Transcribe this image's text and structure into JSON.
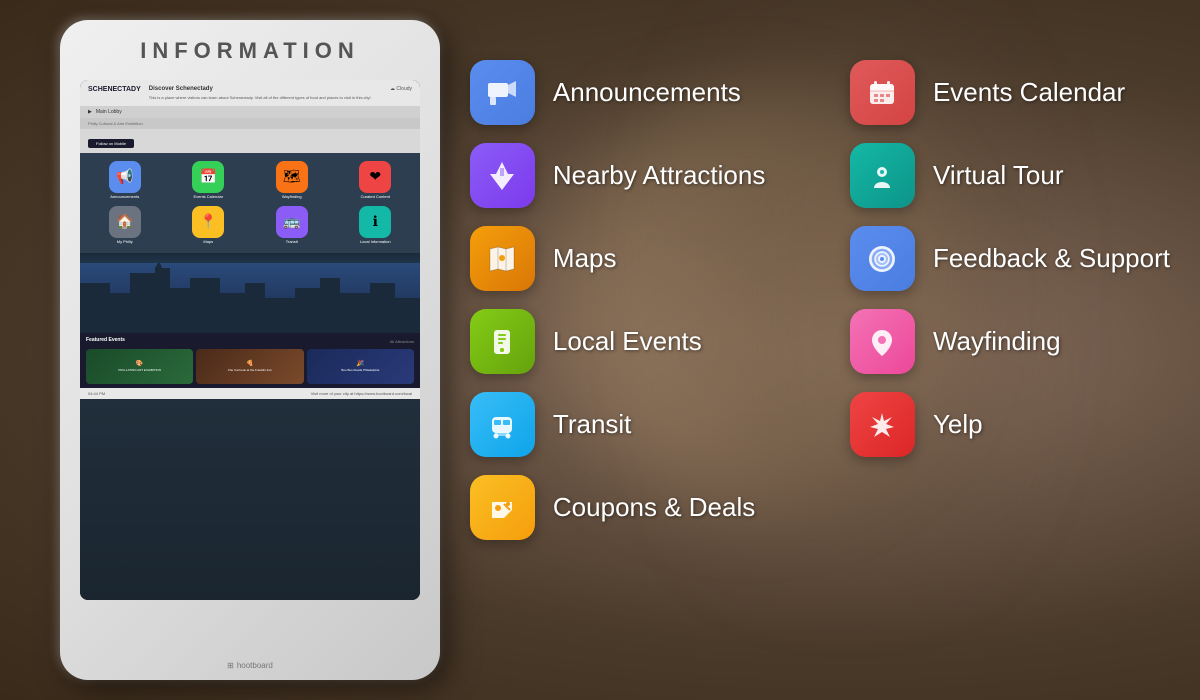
{
  "background": {
    "color": "#5a4a3a"
  },
  "kiosk": {
    "title": "INFORMATION",
    "brand": "hootboard",
    "screen": {
      "city_name": "Discover Schenectady",
      "location_text": "Main Lobby",
      "weather": "☁ Cloudy",
      "bottom_text": "04:44 PM",
      "bottom_url": "Visit more of your city at https://www.hootboard.com/local",
      "featured_label": "Featured Events",
      "icons": [
        {
          "label": "Announcements",
          "color": "sic-blue",
          "icon": "📢"
        },
        {
          "label": "Events Calendar",
          "color": "sic-green",
          "icon": "📅"
        },
        {
          "label": "Wayfinding",
          "color": "sic-orange",
          "icon": "🗺"
        },
        {
          "label": "Curated Content",
          "color": "sic-red",
          "icon": "❤"
        },
        {
          "label": "My Philly",
          "color": "sic-gray",
          "icon": "🏠"
        },
        {
          "label": "Maps",
          "color": "sic-yellow",
          "icon": "📍"
        },
        {
          "label": "Transit",
          "color": "sic-purple",
          "icon": "🚌"
        },
        {
          "label": "Local Information",
          "color": "sic-teal",
          "icon": "ℹ"
        }
      ]
    }
  },
  "menu": {
    "left_column": [
      {
        "id": "announcements",
        "label": "Announcements",
        "icon": "📢",
        "color_class": "ic-blue"
      },
      {
        "id": "nearby-attractions",
        "label": "Nearby Attractions",
        "icon": "🗽",
        "color_class": "ic-purple"
      },
      {
        "id": "maps",
        "label": "Maps",
        "icon": "🗺",
        "color_class": "ic-yellow"
      },
      {
        "id": "local-events",
        "label": "Local Events",
        "icon": "📱",
        "color_class": "ic-lime"
      },
      {
        "id": "transit",
        "label": "Transit",
        "icon": "🚌",
        "color_class": "ic-sky"
      },
      {
        "id": "coupons-deals",
        "label": "Coupons & Deals",
        "icon": "🏷",
        "color_class": "ic-gold"
      }
    ],
    "right_column": [
      {
        "id": "events-calendar",
        "label": "Events Calendar",
        "icon": "📅",
        "color_class": "ic-red"
      },
      {
        "id": "virtual-tour",
        "label": "Virtual Tour",
        "icon": "👤",
        "color_class": "ic-teal"
      },
      {
        "id": "feedback-support",
        "label": "Feedback & Support",
        "icon": "🛟",
        "color_class": "ic-blue"
      },
      {
        "id": "wayfinding",
        "label": "Wayfinding",
        "icon": "📍",
        "color_class": "ic-pink"
      },
      {
        "id": "yelp",
        "label": "Yelp",
        "icon": "⭐",
        "color_class": "ic-yelp"
      }
    ]
  }
}
